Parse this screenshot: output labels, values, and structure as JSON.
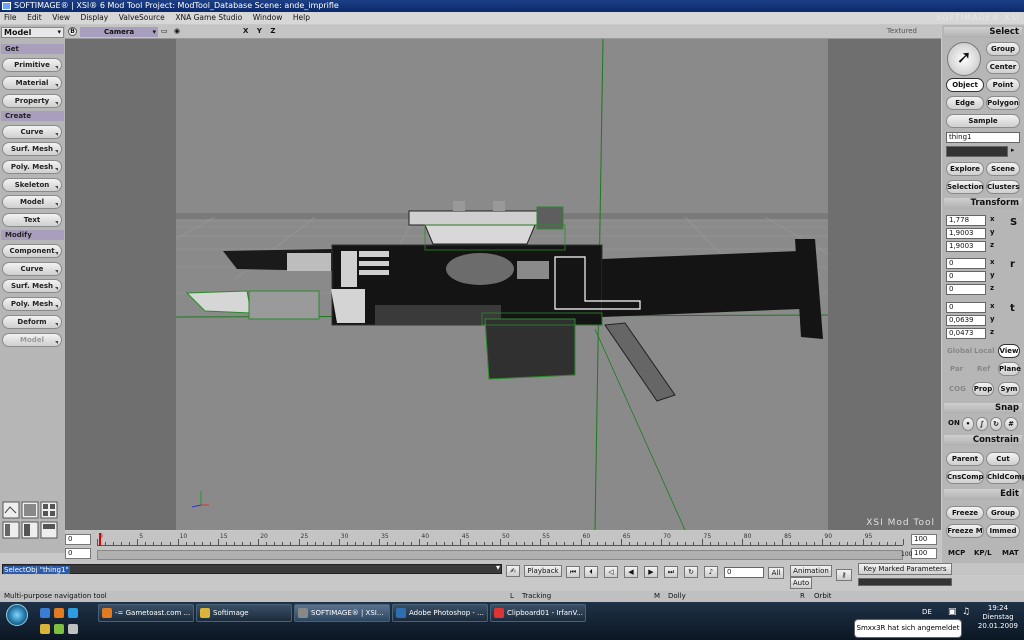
{
  "title": "SOFTIMAGE® | XSI® 6 Mod Tool Project: ModTool_Database   Scene: ande_imprifle",
  "brand": "SOFTIMAGE® XSI",
  "menu": [
    "File",
    "Edit",
    "View",
    "Display",
    "ValveSource",
    "XNA Game Studio",
    "Window",
    "Help"
  ],
  "left_panel": {
    "mode": "Model",
    "sections": {
      "get": "Get",
      "create": "Create",
      "modify": "Modify"
    },
    "get_items": [
      "Primitive",
      "Material",
      "Property"
    ],
    "create_items": [
      "Curve",
      "Surf. Mesh",
      "Poly. Mesh",
      "Skeleton",
      "Model",
      "Text"
    ],
    "modify_items": [
      "Component",
      "Curve",
      "Surf. Mesh",
      "Poly. Mesh",
      "Deform",
      "Model"
    ]
  },
  "viewport": {
    "b_label": "B",
    "camera": "Camera",
    "xyz": "X Y Z",
    "shading": "Textured",
    "watermark": "XSI Mod Tool"
  },
  "timeline": {
    "start_a": "0",
    "start_b": "0",
    "tick_labels": [
      "0",
      "5",
      "10",
      "15",
      "20",
      "25",
      "30",
      "35",
      "40",
      "45",
      "50",
      "55",
      "60",
      "65",
      "70",
      "75",
      "80",
      "85",
      "90",
      "95"
    ],
    "end_a": "100",
    "end_b": "100",
    "end_c": "100"
  },
  "command_line": "SelectObj \"thing1\"",
  "playback": {
    "playback_label": "Playback",
    "frame": "0",
    "all_label": "All",
    "animation_label": "Animation",
    "auto_label": "Auto",
    "key_marked": "Key Marked Parameters"
  },
  "hint_bar": {
    "message": "Multi-purpose navigation tool",
    "l_key": "L",
    "l_label": "Tracking",
    "m_key": "M",
    "m_label": "Dolly",
    "r_key": "R",
    "r_label": "Orbit"
  },
  "right_panel": {
    "select_header": "Select",
    "group": "Group",
    "center": "Center",
    "object": "Object",
    "point": "Point",
    "edge": "Edge",
    "polygon": "Polygon",
    "sample": "Sample",
    "selection_name": "thing1",
    "explore": "Explore",
    "scene": "Scene",
    "selection": "Selection",
    "clusters": "Clusters",
    "transform_header": "Transform",
    "scale": [
      "1,778",
      "1,9003",
      "1,9003"
    ],
    "rotation": [
      "0",
      "0",
      "0"
    ],
    "translation": [
      "0",
      "0,0639",
      "0,0473"
    ],
    "axis_labels": [
      "x",
      "y",
      "z"
    ],
    "global": "Global",
    "local": "Local",
    "view": "View",
    "par": "Par",
    "ref": "Ref",
    "plane": "Plane",
    "cog": "COG",
    "prop": "Prop",
    "sym": "Sym",
    "snap_header": "Snap",
    "snap_on": "ON",
    "constrain_header": "Constrain",
    "parent": "Parent",
    "cut": "Cut",
    "cnscomp": "CnsComp",
    "chldcomp": "ChldComp",
    "edit_header": "Edit",
    "freeze": "Freeze",
    "edit_group": "Group",
    "freeze_m": "Freeze M",
    "immed": "Immed",
    "tabs": [
      "MCP",
      "KP/L",
      "MAT"
    ]
  },
  "taskbar": {
    "items": [
      {
        "label": "-= Gametoast.com ..."
      },
      {
        "label": "Softimage"
      },
      {
        "label": "SOFTIMAGE® | XSI..."
      },
      {
        "label": "Adobe Photoshop - ..."
      },
      {
        "label": "Clipboard01 - IrfanV..."
      }
    ],
    "lang": "DE",
    "time": "19:24",
    "day": "Dienstag",
    "date": "20.01.2009",
    "balloon": "Smxx3R hat sich angemeldet"
  }
}
